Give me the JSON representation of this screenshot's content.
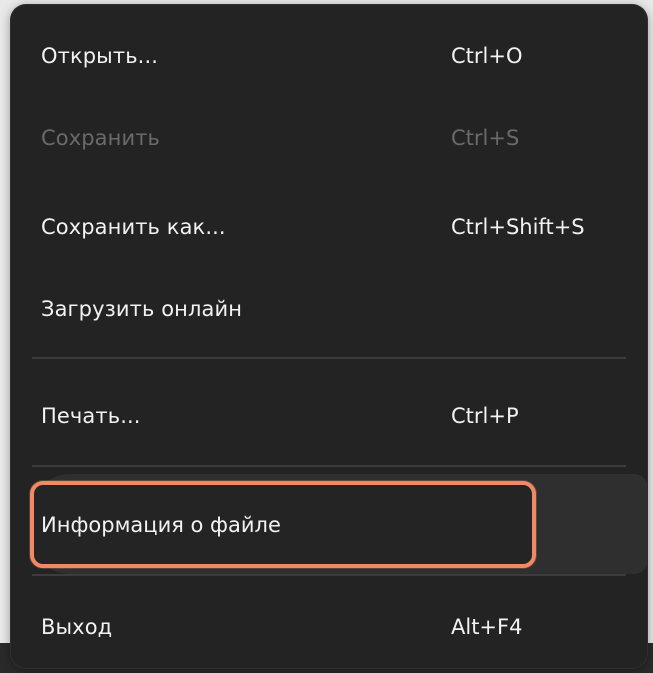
{
  "menu": {
    "items": [
      {
        "label": "Открыть...",
        "shortcut": "Ctrl+O",
        "enabled": true
      },
      {
        "label": "Сохранить",
        "shortcut": "Ctrl+S",
        "enabled": false
      },
      {
        "label": "Сохранить как...",
        "shortcut": "Ctrl+Shift+S",
        "enabled": true
      },
      {
        "label": "Загрузить онлайн",
        "shortcut": "",
        "enabled": true
      },
      {
        "label": "Печать...",
        "shortcut": "Ctrl+P",
        "enabled": true
      },
      {
        "label": "Информация о файле",
        "shortcut": "",
        "enabled": true,
        "highlighted": true
      },
      {
        "label": "Выход",
        "shortcut": "Alt+F4",
        "enabled": true
      }
    ]
  },
  "colors": {
    "menu_background": "#232323",
    "text": "#f2f2f2",
    "disabled_text": "#6a6a6a",
    "separator": "#3c3c3c",
    "highlight_border": "#f08a64"
  }
}
